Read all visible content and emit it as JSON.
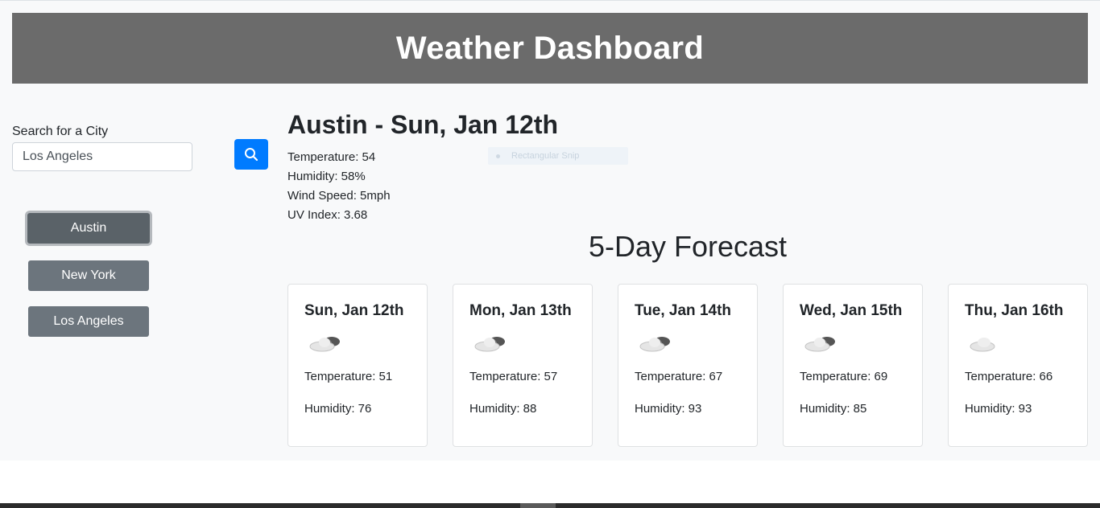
{
  "header": {
    "title": "Weather Dashboard"
  },
  "search": {
    "label": "Search for a City",
    "value": "Los Angeles",
    "icon": "search-icon"
  },
  "history": [
    {
      "label": "Austin",
      "active": true
    },
    {
      "label": "New York",
      "active": false
    },
    {
      "label": "Los Angeles",
      "active": false
    }
  ],
  "current": {
    "title": "Austin - Sun, Jan 12th",
    "temperature": "Temperature: 54",
    "humidity": "Humidity: 58%",
    "wind": "Wind Speed: 5mph",
    "uv": "UV Index: 3.68"
  },
  "overlay": {
    "label": "Rectangular Snip"
  },
  "forecast": {
    "title": "5-Day Forecast",
    "days": [
      {
        "date": "Sun, Jan 12th",
        "icon": "partly-cloudy-icon",
        "temp": "Temperature: 51",
        "humidity": "Humidity: 76"
      },
      {
        "date": "Mon, Jan 13th",
        "icon": "partly-cloudy-icon",
        "temp": "Temperature: 57",
        "humidity": "Humidity: 88"
      },
      {
        "date": "Tue, Jan 14th",
        "icon": "partly-cloudy-icon",
        "temp": "Temperature: 67",
        "humidity": "Humidity: 93"
      },
      {
        "date": "Wed, Jan 15th",
        "icon": "partly-cloudy-icon",
        "temp": "Temperature: 69",
        "humidity": "Humidity: 85"
      },
      {
        "date": "Thu, Jan 16th",
        "icon": "cloud-icon",
        "temp": "Temperature: 66",
        "humidity": "Humidity: 93"
      }
    ]
  },
  "colors": {
    "header_bg": "#6b6b6b",
    "search_button": "#007bff",
    "city_button": "#6c757d",
    "page_bg": "#f8f9fa"
  }
}
